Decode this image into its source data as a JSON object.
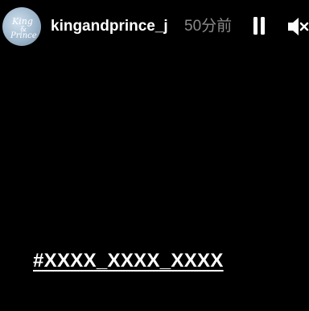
{
  "header": {
    "avatar_logo_text": "King & Prince",
    "username": "kingandprince_j",
    "timestamp": "50分前",
    "icons": {
      "pause": "pause-icon",
      "mute": "speaker-muted-icon"
    }
  },
  "story": {
    "hashtag": "#XXXX_XXXX_XXXX"
  },
  "colors": {
    "background": "#000000",
    "text": "#ffffff",
    "timestamp": "#8a8a8a"
  }
}
